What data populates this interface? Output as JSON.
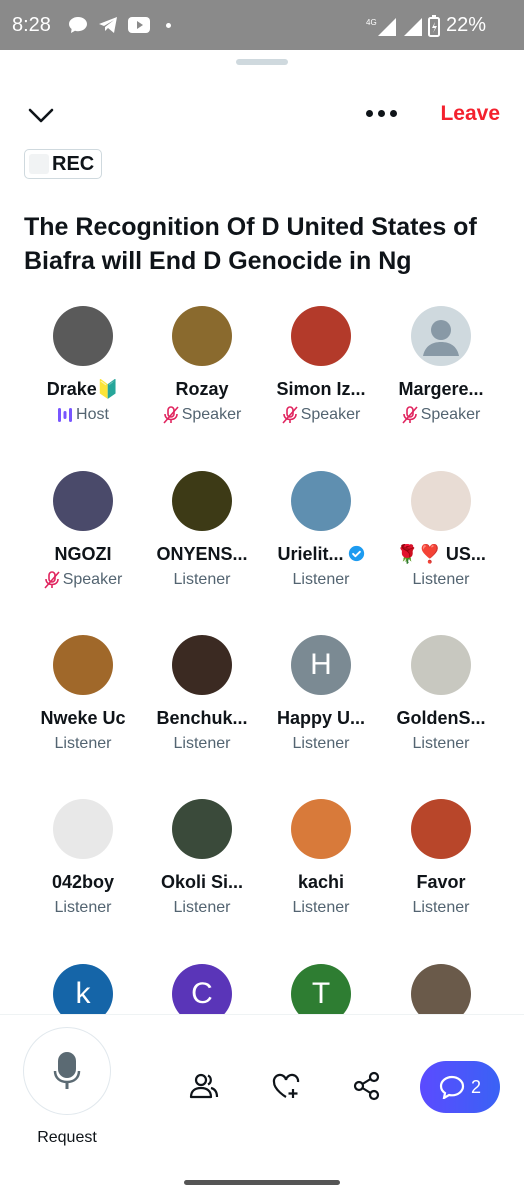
{
  "status": {
    "time": "8:28",
    "network": "4G",
    "battery": "22%"
  },
  "header": {
    "leave_label": "Leave"
  },
  "rec": {
    "label": "REC"
  },
  "space": {
    "title": "The Recognition Of D United States of Biafra will End D Genocide in Ng"
  },
  "participants": [
    {
      "name": "Drake🔰",
      "role": "Host",
      "role_icon": "host-bars-icon",
      "avatar_color": "#5a5a5a"
    },
    {
      "name": "Rozay",
      "role": "Speaker",
      "role_icon": "muted-mic-icon",
      "avatar_color": "#8a6a2e"
    },
    {
      "name": "Simon Iz...",
      "role": "Speaker",
      "role_icon": "muted-mic-icon",
      "avatar_color": "#b33a2a"
    },
    {
      "name": "Margere...",
      "role": "Speaker",
      "role_icon": "muted-mic-icon",
      "avatar_color": "#cfd9de"
    },
    {
      "name": "NGOZI",
      "role": "Speaker",
      "role_icon": "muted-mic-icon",
      "avatar_color": "#4a4a6a"
    },
    {
      "name": "ONYENS...",
      "role": "Listener",
      "avatar_color": "#3d3a16"
    },
    {
      "name": "Urielit...",
      "role": "Listener",
      "verified": true,
      "avatar_color": "#5f8fb0"
    },
    {
      "name": "🌹❣️ US...",
      "role": "Listener",
      "avatar_color": "#e8dcd4"
    },
    {
      "name": "Nweke Uc",
      "role": "Listener",
      "avatar_color": "#a0682a"
    },
    {
      "name": "Benchuk...",
      "role": "Listener",
      "avatar_color": "#3b2a22"
    },
    {
      "name": "Happy U...",
      "role": "Listener",
      "avatar_letter": "H",
      "avatar_color": "#7b8a93"
    },
    {
      "name": "GoldenS...",
      "role": "Listener",
      "avatar_color": "#c8c8c0"
    },
    {
      "name": "042boy",
      "role": "Listener",
      "avatar_color": "#e8e8e8"
    },
    {
      "name": "Okoli Si...",
      "role": "Listener",
      "avatar_color": "#3a4a3a"
    },
    {
      "name": "kachi",
      "role": "Listener",
      "avatar_color": "#d87a3a"
    },
    {
      "name": "Favor",
      "role": "Listener",
      "avatar_color": "#b8462a"
    },
    {
      "name": "",
      "role": "",
      "avatar_letter": "k",
      "avatar_color": "#1565a8"
    },
    {
      "name": "",
      "role": "",
      "avatar_letter": "C",
      "avatar_color": "#5a35b8"
    },
    {
      "name": "",
      "role": "",
      "avatar_letter": "T",
      "avatar_color": "#2e7d32"
    },
    {
      "name": "",
      "role": "",
      "avatar_color": "#6a5a4a"
    }
  ],
  "bottom": {
    "request_label": "Request",
    "chat_count": "2"
  },
  "colors": {
    "accent": "#1d9bf0",
    "leave": "#f4212e",
    "speaker_mic": "#e0245e",
    "host": "#7856ff"
  }
}
